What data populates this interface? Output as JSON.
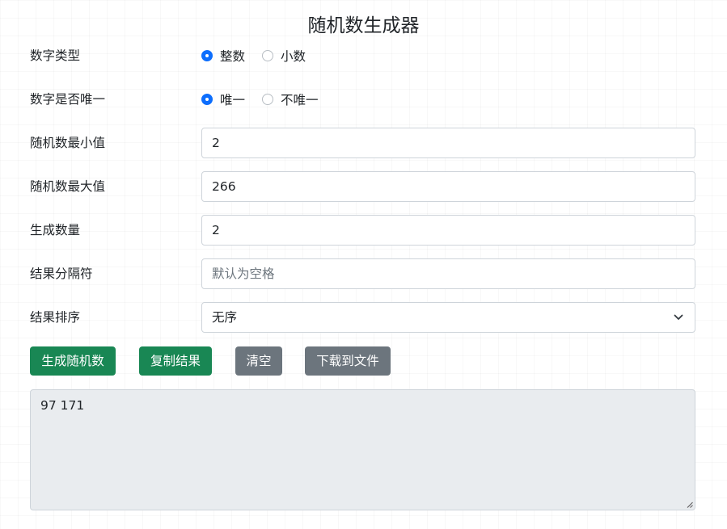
{
  "title": "随机数生成器",
  "form": {
    "number_type": {
      "label": "数字类型",
      "options": [
        {
          "label": "整数",
          "checked": true
        },
        {
          "label": "小数",
          "checked": false
        }
      ]
    },
    "unique": {
      "label": "数字是否唯一",
      "options": [
        {
          "label": "唯一",
          "checked": true
        },
        {
          "label": "不唯一",
          "checked": false
        }
      ]
    },
    "min_value": {
      "label": "随机数最小值",
      "value": "2"
    },
    "max_value": {
      "label": "随机数最大值",
      "value": "266"
    },
    "count": {
      "label": "生成数量",
      "value": "2"
    },
    "separator": {
      "label": "结果分隔符",
      "value": "",
      "placeholder": "默认为空格"
    },
    "sort": {
      "label": "结果排序",
      "selected": "无序"
    }
  },
  "buttons": {
    "generate": "生成随机数",
    "copy": "复制结果",
    "clear": "清空",
    "download": "下载到文件"
  },
  "output": {
    "value": "97 171"
  },
  "colors": {
    "primary": "#0d6efd",
    "success": "#198754",
    "secondary": "#6c757d",
    "readonly_bg": "#e9ecef"
  },
  "icons": {
    "select_arrow": "chevron-down-icon",
    "textarea_resize": "resize-handle-icon"
  }
}
